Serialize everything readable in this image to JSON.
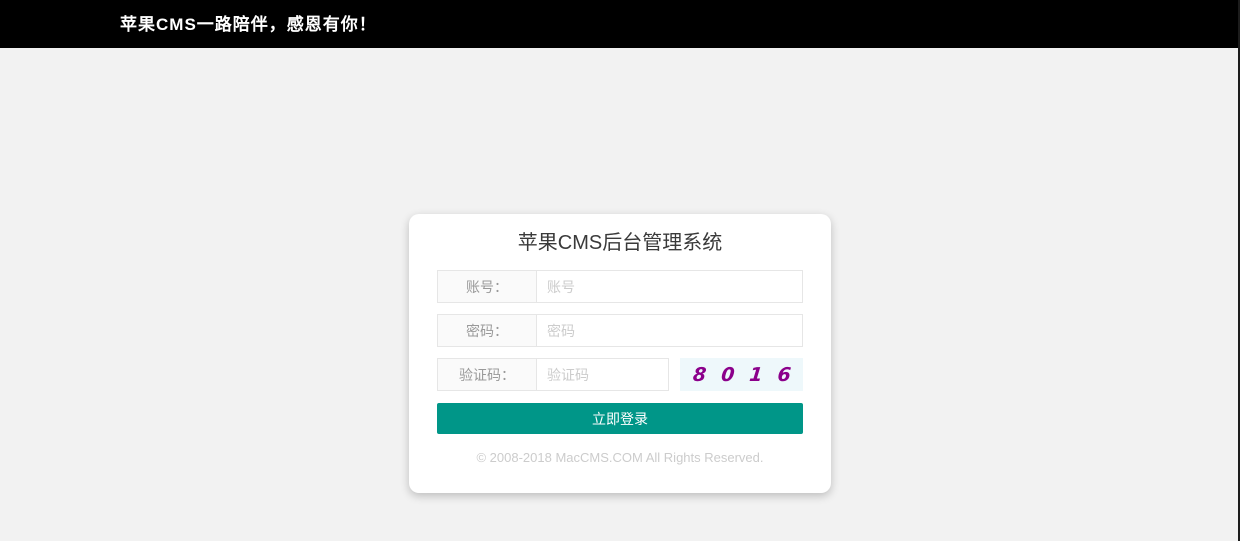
{
  "topbar": {
    "message": "苹果CMS一路陪伴，感恩有你！"
  },
  "login_card": {
    "title": "苹果CMS后台管理系统",
    "fields": [
      {
        "id": "username",
        "label": "账号：",
        "placeholder": "账号"
      },
      {
        "id": "password",
        "label": "密码：",
        "placeholder": "密码"
      },
      {
        "id": "captcha",
        "label": "验证码：",
        "placeholder": "验证码"
      }
    ],
    "captcha": {
      "code": "8016"
    },
    "submit_label": "立即登录",
    "footer": "© 2008-2018 MacCMS.COM All Rights Reserved."
  },
  "colors": {
    "topbar_bg": "#000000",
    "page_bg": "#f2f2f2",
    "card_bg": "#ffffff",
    "border": "#e6e6e6",
    "label_bg": "#fafafa",
    "label_text": "#999999",
    "placeholder_text": "#cccccc",
    "button_bg": "#009688",
    "button_text": "#ffffff",
    "captcha_bg": "#eef8fb",
    "captcha_text": "#8b008b",
    "footer_text": "#cccccc"
  }
}
